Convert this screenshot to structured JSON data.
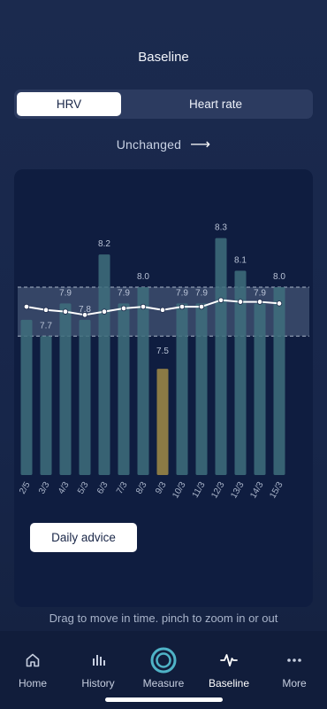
{
  "screen": {
    "title": "Baseline"
  },
  "tabs": {
    "hrv": "HRV",
    "heart_rate": "Heart rate",
    "selected": "HRV"
  },
  "status": {
    "text": "Unchanged",
    "arrow": "⟶"
  },
  "advice_button": "Daily advice",
  "hint": "Drag to move in time. pinch to zoom in or out",
  "nav": [
    {
      "label": "Home",
      "icon": "home-icon"
    },
    {
      "label": "History",
      "icon": "bar-chart-icon"
    },
    {
      "label": "Measure",
      "icon": "ring-icon"
    },
    {
      "label": "Baseline",
      "icon": "pulse-icon"
    },
    {
      "label": "More",
      "icon": "dots-icon"
    }
  ],
  "colors": {
    "bar": "#3e6e7d",
    "bar_highlight": "#3a7d87",
    "bar_out": "#8b7a45",
    "band": "#9ab0c8",
    "line": "#ffffff"
  },
  "chart_data": {
    "type": "bar",
    "categories": [
      "2/5",
      "3/3",
      "4/3",
      "5/3",
      "6/3",
      "7/3",
      "8/3",
      "9/3",
      "10/3",
      "11/3",
      "12/3",
      "13/3",
      "14/3",
      "15/3"
    ],
    "values": [
      7.8,
      7.7,
      7.9,
      7.8,
      8.2,
      7.9,
      8.0,
      7.5,
      7.9,
      7.9,
      8.3,
      8.1,
      7.9,
      8.0
    ],
    "value_labels": [
      "",
      "7.7",
      "7.9",
      "7.8",
      "8.2",
      "7.9",
      "8.0",
      "7.5",
      "7.9",
      "7.9",
      "8.3",
      "8.1",
      "7.9",
      "8.0"
    ],
    "outside_range": [
      false,
      false,
      false,
      false,
      false,
      false,
      false,
      true,
      false,
      false,
      false,
      false,
      false,
      false
    ],
    "baseline": [
      7.88,
      7.86,
      7.85,
      7.83,
      7.85,
      7.87,
      7.88,
      7.86,
      7.88,
      7.88,
      7.92,
      7.91,
      7.91,
      7.9
    ],
    "normal_range": [
      7.7,
      8.0
    ],
    "ylim": [
      6.85,
      8.45
    ],
    "xlabel": "",
    "ylabel": "",
    "grid": false
  }
}
